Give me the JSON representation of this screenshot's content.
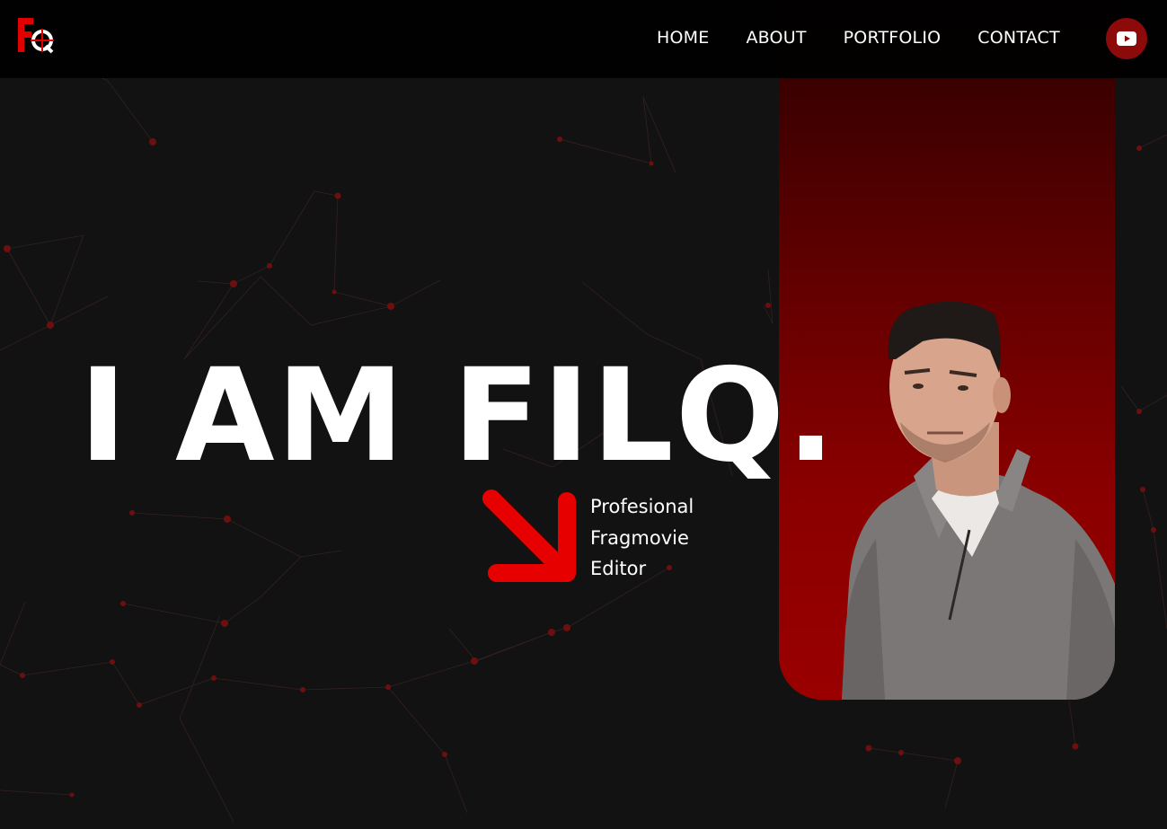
{
  "nav": {
    "items": [
      {
        "label": "HOME"
      },
      {
        "label": "ABOUT"
      },
      {
        "label": "PORTFOLIO"
      },
      {
        "label": "CONTACT"
      }
    ],
    "social_icon": "youtube-icon"
  },
  "logo": {
    "text": "FQ"
  },
  "hero": {
    "title": "I AM FILQ.",
    "subtitle_lines": [
      "Profesional",
      "Fragmovie",
      "Editor"
    ],
    "arrow_icon": "arrow-down-right-icon"
  },
  "colors": {
    "accent": "#e00000",
    "background": "#121212",
    "panel_dark": "#2a0000",
    "panel_light": "#9a0000",
    "youtube_button": "#8c0a0a"
  }
}
